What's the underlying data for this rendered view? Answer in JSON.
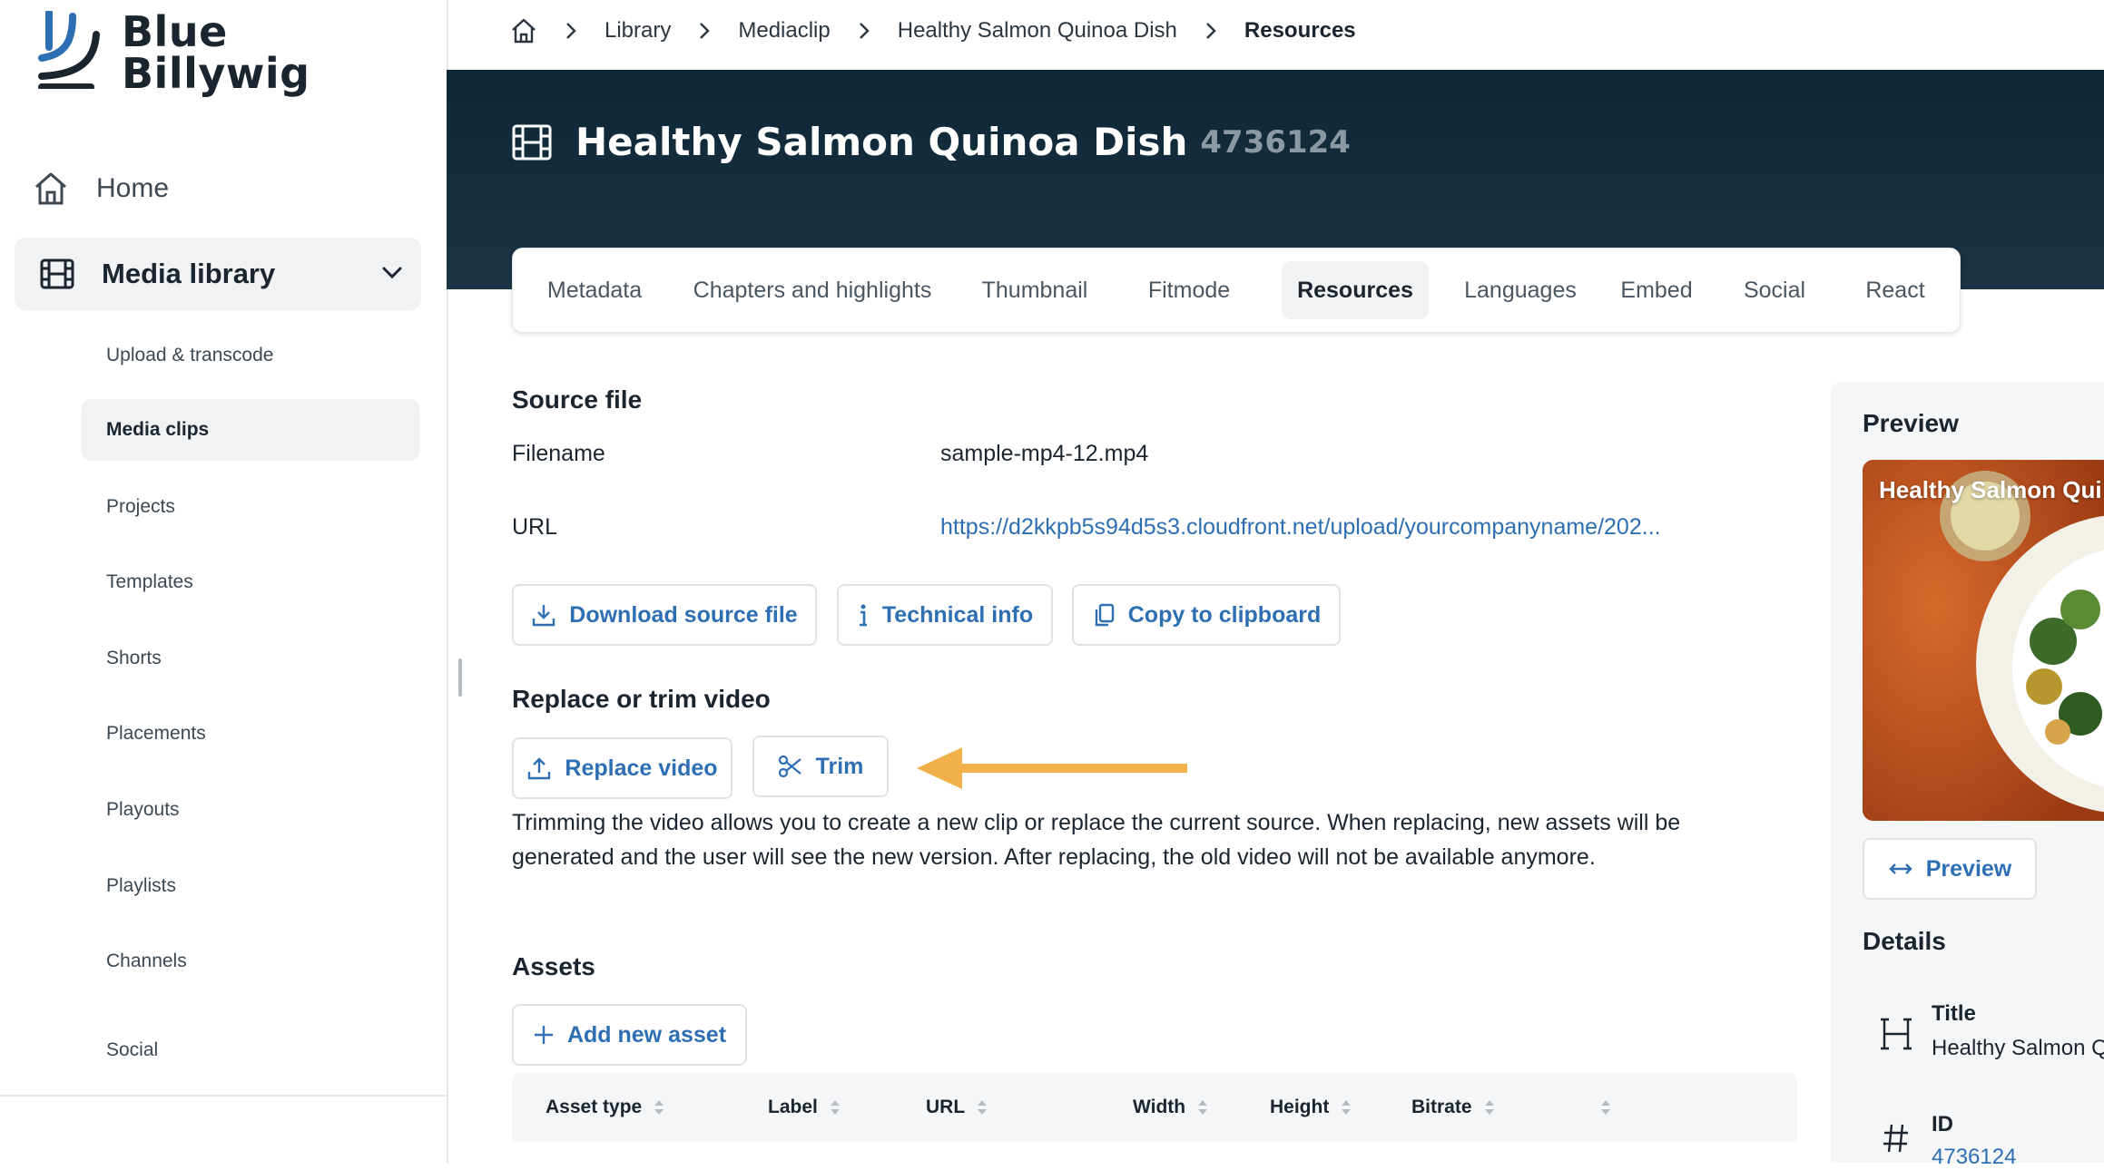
{
  "brand": {
    "line1": "Blue",
    "line2": "Billywig"
  },
  "sidebar": {
    "home_label": "Home",
    "media_library_label": "Media library",
    "sub_items": [
      {
        "label": "Upload & transcode",
        "active": false
      },
      {
        "label": "Media clips",
        "active": true
      },
      {
        "label": "Projects",
        "active": false
      },
      {
        "label": "Templates",
        "active": false
      },
      {
        "label": "Shorts",
        "active": false
      },
      {
        "label": "Placements",
        "active": false
      },
      {
        "label": "Playouts",
        "active": false
      },
      {
        "label": "Playlists",
        "active": false
      },
      {
        "label": "Channels",
        "active": false
      },
      {
        "label": "Social",
        "active": false
      }
    ]
  },
  "breadcrumb": {
    "items": [
      "Library",
      "Mediaclip",
      "Healthy Salmon Quinoa Dish"
    ],
    "current": "Resources"
  },
  "hero": {
    "title": "Healthy Salmon Quinoa Dish",
    "clip_id": "4736124"
  },
  "tabs": [
    "Metadata",
    "Chapters and highlights",
    "Thumbnail",
    "Fitmode",
    "Resources",
    "Languages",
    "Embed",
    "Social",
    "React"
  ],
  "active_tab": "Resources",
  "source_file": {
    "heading": "Source file",
    "filename_label": "Filename",
    "filename_value": "sample-mp4-12.mp4",
    "url_label": "URL",
    "url_value": "https://d2kkpb5s94d5s3.cloudfront.net/upload/yourcompanyname/202...",
    "buttons": {
      "download": "Download source file",
      "technical": "Technical info",
      "copy": "Copy to clipboard"
    }
  },
  "replace": {
    "heading": "Replace or trim video",
    "replace_label": "Replace video",
    "trim_label": "Trim",
    "description": "Trimming the video allows you to create a new clip or replace the current source. When replacing, new assets will be generated and the user will see the new version. After replacing, the old video will not be available anymore."
  },
  "assets": {
    "heading": "Assets",
    "add_label": "Add new asset",
    "columns": [
      "Asset type",
      "Label",
      "URL",
      "Width",
      "Height",
      "Bitrate"
    ]
  },
  "preview_panel": {
    "heading": "Preview",
    "thumbnail_caption": "Healthy Salmon Qui",
    "preview_button": "Preview",
    "details_heading": "Details",
    "title_label": "Title",
    "title_value": "Healthy Salmon Q",
    "id_label": "ID",
    "id_value": "4736124"
  },
  "colors": {
    "accent": "#2e6fb3",
    "hero_bg": "#0d2737",
    "annotation_arrow": "#f2b04a"
  }
}
